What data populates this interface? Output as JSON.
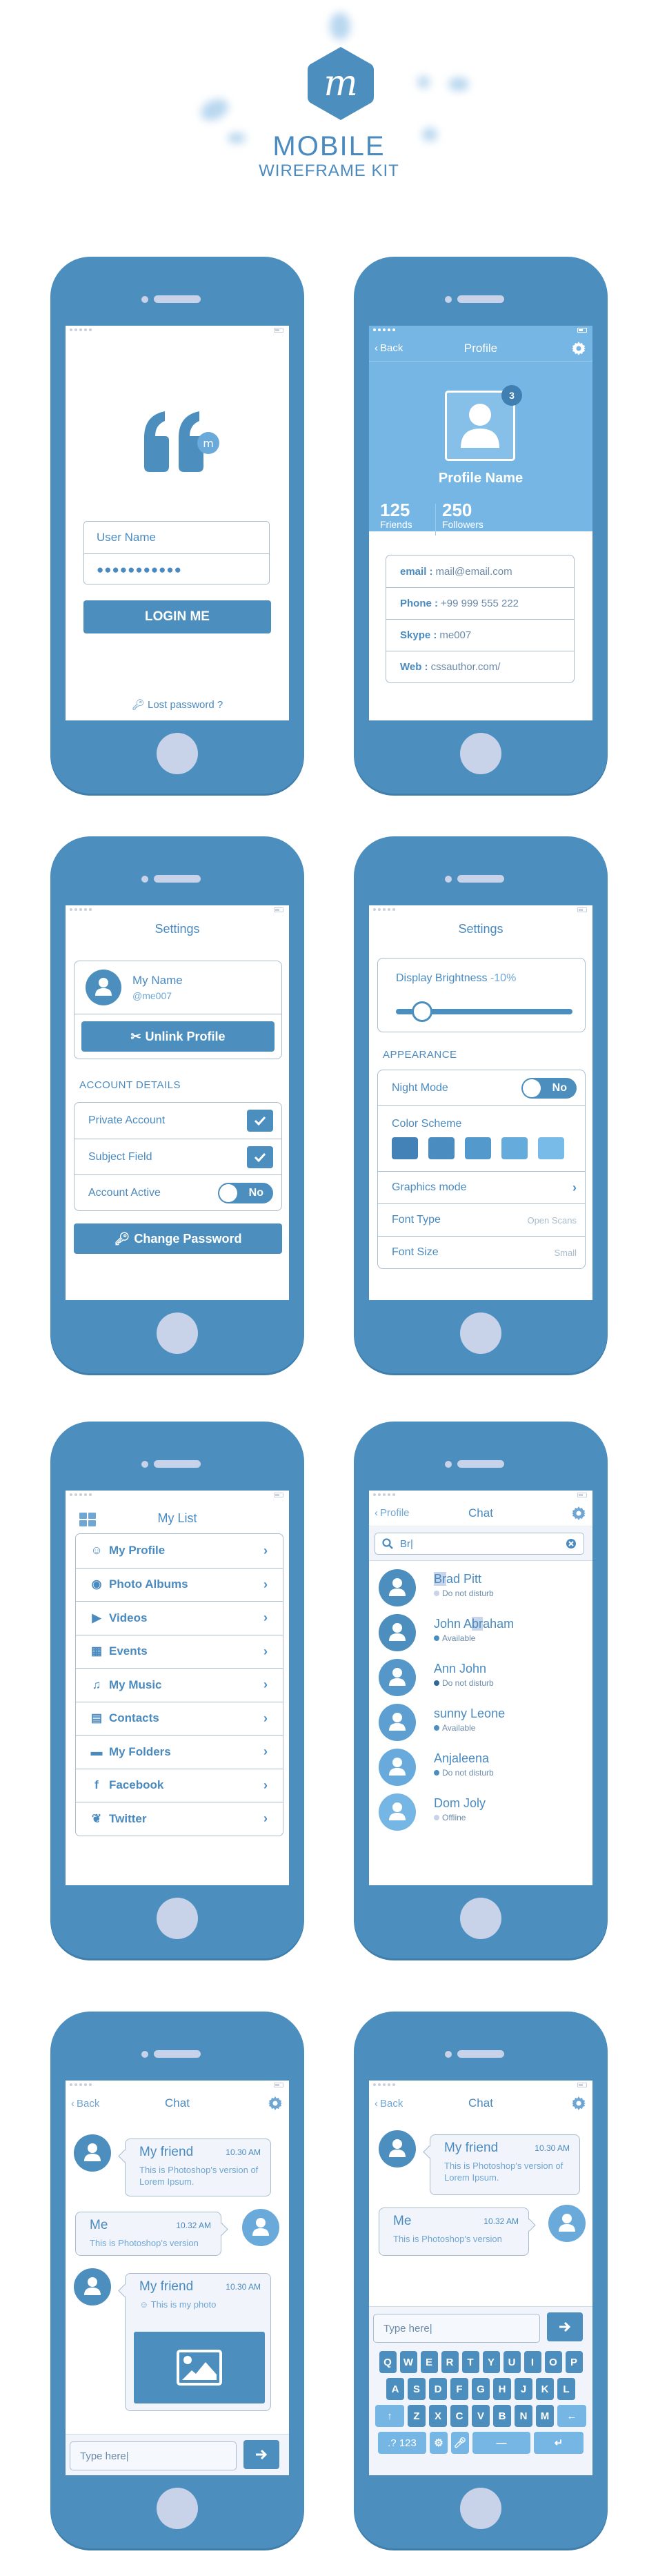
{
  "brand": {
    "logo_letter": "m",
    "title": "MOBILE",
    "subtitle": "WIREFRAME KIT"
  },
  "colors": {
    "frame": "#4c8fbf",
    "accent": "#4a8abf",
    "light_accent": "#76b6e4",
    "border": "#a9bccd",
    "button_face": "#c8d2e8"
  },
  "login": {
    "logo_badge": "m",
    "username_placeholder": "User Name",
    "password_masked": "●●●●●●●●●●●",
    "login_button": "LOGIN ME",
    "lost_password": "Lost password ?"
  },
  "profile": {
    "back": "Back",
    "title": "Profile",
    "notification_count": "3",
    "name": "Profile Name",
    "friends_count": "125",
    "friends_label": "Friends",
    "followers_count": "250",
    "followers_label": "Followers",
    "info": [
      {
        "key": "email :",
        "value": "mail@email.com"
      },
      {
        "key": "Phone :",
        "value": "+99 999 555 222"
      },
      {
        "key": "Skype :",
        "value": "me007"
      },
      {
        "key": "Web :",
        "value": "cssauthor.com/"
      }
    ]
  },
  "account_settings": {
    "title": "Settings",
    "user_name": "My Name",
    "user_handle": "@me007",
    "unlink_button": "Unlink Profile",
    "section": "ACCOUNT DETAILS",
    "rows": [
      {
        "label": "Private Account",
        "control": "checkbox",
        "checked": true
      },
      {
        "label": "Subject Field",
        "control": "checkbox",
        "checked": true
      },
      {
        "label": "Account Active",
        "control": "toggle",
        "value": "No"
      }
    ],
    "change_password_button": "Change Password"
  },
  "display_settings": {
    "title": "Settings",
    "brightness_label": "Display Brightness",
    "brightness_value": "-10%",
    "brightness_slider_fraction": 0.1,
    "section": "APPEARANCE",
    "night_mode_label": "Night Mode",
    "night_mode_value": "No",
    "color_scheme_label": "Color Scheme",
    "color_scheme_swatches": [
      "#4382b6",
      "#4a8cc0",
      "#5399cc",
      "#65abdc",
      "#78bbe8"
    ],
    "graphics_mode_label": "Graphics mode",
    "font_type_label": "Font Type",
    "font_type_value": "Open Scans",
    "font_size_label": "Font Size",
    "font_size_value": "Small"
  },
  "my_list": {
    "title": "My List",
    "items": [
      {
        "label": "My Profile",
        "icon": "user-icon"
      },
      {
        "label": "Photo Albums",
        "icon": "camera-icon"
      },
      {
        "label": "Videos",
        "icon": "video-icon"
      },
      {
        "label": "Events",
        "icon": "calendar-icon"
      },
      {
        "label": "My Music",
        "icon": "music-icon"
      },
      {
        "label": "Contacts",
        "icon": "book-icon"
      },
      {
        "label": "My Folders",
        "icon": "folder-icon"
      },
      {
        "label": "Facebook",
        "icon": "facebook-icon"
      },
      {
        "label": "Twitter",
        "icon": "twitter-icon"
      }
    ]
  },
  "chat_list": {
    "back": "Profile",
    "title": "Chat",
    "search_value": "Br|",
    "contacts": [
      {
        "name": "Brad Pitt",
        "status": "Do not disturb",
        "status_color": "#c8d2e8",
        "avatar_color": "#4c8fbf"
      },
      {
        "name": "John Abraham",
        "status": "Available",
        "status_color": "#4c8fbf",
        "avatar_color": "#4c8fbf"
      },
      {
        "name": "Ann John",
        "status": "Do not disturb",
        "status_color": "#2f6796",
        "avatar_color": "#5597c8"
      },
      {
        "name": "sunny Leone",
        "status": "Available",
        "status_color": "#4c8fbf",
        "avatar_color": "#5d9fd0"
      },
      {
        "name": "Anjaleena",
        "status": "Do not disturb",
        "status_color": "#4c8fbf",
        "avatar_color": "#67aadb"
      },
      {
        "name": "Dom Joly",
        "status": "Offline",
        "status_color": "#c8d2e8",
        "avatar_color": "#76b6e4"
      }
    ]
  },
  "chat_photo": {
    "back": "Back",
    "title": "Chat",
    "messages": [
      {
        "from": "My friend",
        "time": "10.30 AM",
        "text": "This is Photoshop's version of Lorem Ipsum."
      },
      {
        "from": "Me",
        "time": "10.32 AM",
        "text": "This is Photoshop's version"
      },
      {
        "from": "My friend",
        "time": "10.30 AM",
        "text": "This is my photo"
      }
    ],
    "compose_placeholder": "Type here|"
  },
  "chat_keyboard": {
    "back": "Back",
    "title": "Chat",
    "messages": [
      {
        "from": "My friend",
        "time": "10.30 AM",
        "text": "This is Photoshop's version of Lorem Ipsum."
      },
      {
        "from": "Me",
        "time": "10.32 AM",
        "text": "This is Photoshop's version"
      }
    ],
    "compose_placeholder": "Type here|",
    "keyboard": {
      "row1": [
        "Q",
        "W",
        "E",
        "R",
        "T",
        "Y",
        "U",
        "I",
        "O",
        "P"
      ],
      "row2": [
        "A",
        "S",
        "D",
        "F",
        "G",
        "H",
        "J",
        "K",
        "L"
      ],
      "row3": [
        "Z",
        "X",
        "C",
        "V",
        "B",
        "N",
        "M"
      ],
      "numbers_key": ".? 123"
    }
  }
}
